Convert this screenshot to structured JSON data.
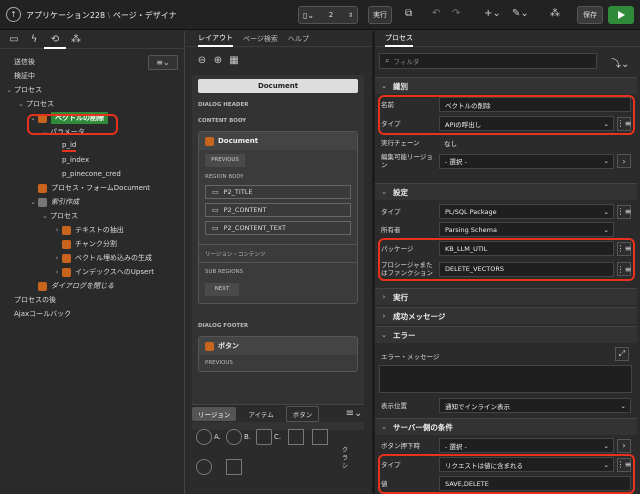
{
  "header": {
    "app_title": "アプリケーション228",
    "sep": "\\",
    "page_title": "ページ・デザイナ",
    "page_number": "2",
    "run_label": "実行",
    "save_label": "保存"
  },
  "left": {
    "tree": [
      {
        "label": "送信後",
        "indent": 0,
        "chev": "",
        "icon": ""
      },
      {
        "label": "検証中",
        "indent": 0,
        "chev": "",
        "icon": ""
      },
      {
        "label": "プロセス",
        "indent": 0,
        "chev": "⌄",
        "icon": ""
      },
      {
        "label": "プロセス",
        "indent": 1,
        "chev": "⌄",
        "icon": ""
      },
      {
        "label": "ベクトルの削除",
        "indent": 2,
        "chev": "⌄",
        "icon": "green",
        "selected": true
      },
      {
        "label": "パラメータ",
        "indent": 3,
        "chev": "⌄",
        "icon": ""
      },
      {
        "label": "p_id",
        "indent": 4,
        "chev": "",
        "icon": "",
        "underline": true
      },
      {
        "label": "p_index",
        "indent": 4,
        "chev": "",
        "icon": ""
      },
      {
        "label": "p_pinecone_cred",
        "indent": 4,
        "chev": "",
        "icon": ""
      },
      {
        "label": "プロセス・フォームDocument",
        "indent": 2,
        "chev": "",
        "icon": "orange"
      },
      {
        "label": "索引作成",
        "indent": 2,
        "chev": "⌄",
        "icon": "gray",
        "italic": true
      },
      {
        "label": "プロセス",
        "indent": 3,
        "chev": "⌄",
        "icon": ""
      },
      {
        "label": "テキストの抽出",
        "indent": 4,
        "chev": "›",
        "icon": "orange"
      },
      {
        "label": "チャンク分割",
        "indent": 4,
        "chev": "",
        "icon": "orange"
      },
      {
        "label": "ベクトル埋め込みの生成",
        "indent": 4,
        "chev": "›",
        "icon": "orange"
      },
      {
        "label": "インデックスへのUpsert",
        "indent": 4,
        "chev": "›",
        "icon": "orange"
      },
      {
        "label": "ダイアログを閉じる",
        "indent": 2,
        "chev": "",
        "icon": "orange",
        "italic": true
      },
      {
        "label": "プロセスの後",
        "indent": 0,
        "chev": "",
        "icon": ""
      },
      {
        "label": "Ajaxコールバック",
        "indent": 0,
        "chev": "",
        "icon": ""
      }
    ]
  },
  "middle": {
    "tabs": [
      "レイアウト",
      "ページ検索",
      "ヘルプ"
    ],
    "document_label": "Document",
    "dialog_header": "DIALOG HEADER",
    "content_body": "CONTENT BODY",
    "region_title": "Document",
    "previous": "PREVIOUS",
    "region_body": "REGION BODY",
    "items": [
      "P2_TITLE",
      "P2_CONTENT",
      "P2_CONTENT_TEXT"
    ],
    "region_content": "リージョン・コンテンツ",
    "sub_regions": "SUB REGIONS",
    "next": "NEXT",
    "dialog_footer": "DIALOG FOOTER",
    "button_region": "ボタン",
    "previous2": "PREVIOUS",
    "gallery_tabs": [
      "リージョン",
      "アイテム",
      "ボタン"
    ],
    "gallery_labels": [
      "A.",
      "B.",
      "C.",
      "クラシ"
    ]
  },
  "right": {
    "tab": "プロセス",
    "filter_placeholder": "フィルタ",
    "sections": {
      "identification": "識別",
      "settings": "設定",
      "execution": "実行",
      "success": "成功メッセージ",
      "error": "エラー",
      "server_condition": "サーバー側の条件"
    },
    "fields": {
      "name_label": "名前",
      "name_value": "ベクトルの削除",
      "type_label": "タイプ",
      "type_value": "APIの呼出し",
      "chain_label": "実行チェーン",
      "chain_value": "なし",
      "editable_label": "編集可能リージョン",
      "editable_value": "- 選択 -",
      "set_type_label": "タイプ",
      "set_type_value": "PL/SQL Package",
      "owner_label": "所有者",
      "owner_value": "Parsing Schema",
      "package_label": "パッケージ",
      "package_value": "KB_LLM_UTIL",
      "proc_label": "プロシージャまたはファンクション",
      "proc_value": "DELETE_VECTORS",
      "errmsg_label": "エラー・メッセージ",
      "display_label": "表示位置",
      "display_value": "通知でインライン表示",
      "btn_pressed_label": "ボタン押下時",
      "btn_pressed_value": "- 選択 -",
      "cond_type_label": "タイプ",
      "cond_type_value": "リクエストは値に含まれる",
      "value_label": "値",
      "value_value": "SAVE,DELETE"
    }
  }
}
